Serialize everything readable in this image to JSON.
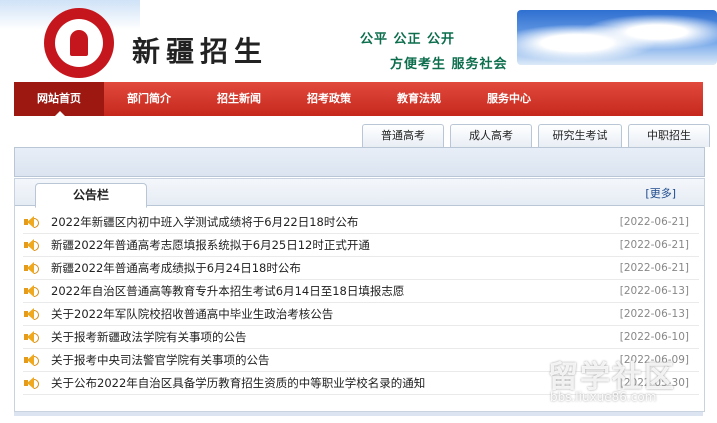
{
  "header": {
    "site_title": "新疆招生",
    "slogan_line1": "公平 公正 公开",
    "slogan_line2": "方便考生  服务社会"
  },
  "nav": {
    "items": [
      "网站首页",
      "部门简介",
      "招生新闻",
      "招考政策",
      "教育法规",
      "服务中心"
    ]
  },
  "subtabs": [
    "普通高考",
    "成人高考",
    "研究生考试",
    "中职招生"
  ],
  "notice": {
    "tab_label": "公告栏",
    "more_label": "[更多]",
    "items": [
      {
        "title": "2022年新疆区内初中班入学测试成绩将于6月22日18时公布",
        "date": "[2022-06-21]"
      },
      {
        "title": "新疆2022年普通高考志愿填报系统拟于6月25日12时正式开通",
        "date": "[2022-06-21]"
      },
      {
        "title": "新疆2022年普通高考成绩拟于6月24日18时公布",
        "date": "[2022-06-21]"
      },
      {
        "title": "2022年自治区普通高等教育专升本招生考试6月14日至18日填报志愿",
        "date": "[2022-06-13]"
      },
      {
        "title": "关于2022年军队院校招收普通高中毕业生政治考核公告",
        "date": "[2022-06-13]"
      },
      {
        "title": "关于报考新疆政法学院有关事项的公告",
        "date": "[2022-06-10]"
      },
      {
        "title": "关于报考中央司法警官学院有关事项的公告",
        "date": "[2022-06-09]"
      },
      {
        "title": "关于公布2022年自治区具备学历教育招生资质的中等职业学校名录的通知",
        "date": "[2022-05-30]"
      }
    ]
  },
  "watermark": {
    "text": "留学社区",
    "url": "bbs.liuxue86.com"
  },
  "colors": {
    "nav_red": "#c6271d",
    "nav_active": "#9c1811",
    "slogan_green": "#0d6e4e",
    "more_blue": "#1e4a8c"
  }
}
